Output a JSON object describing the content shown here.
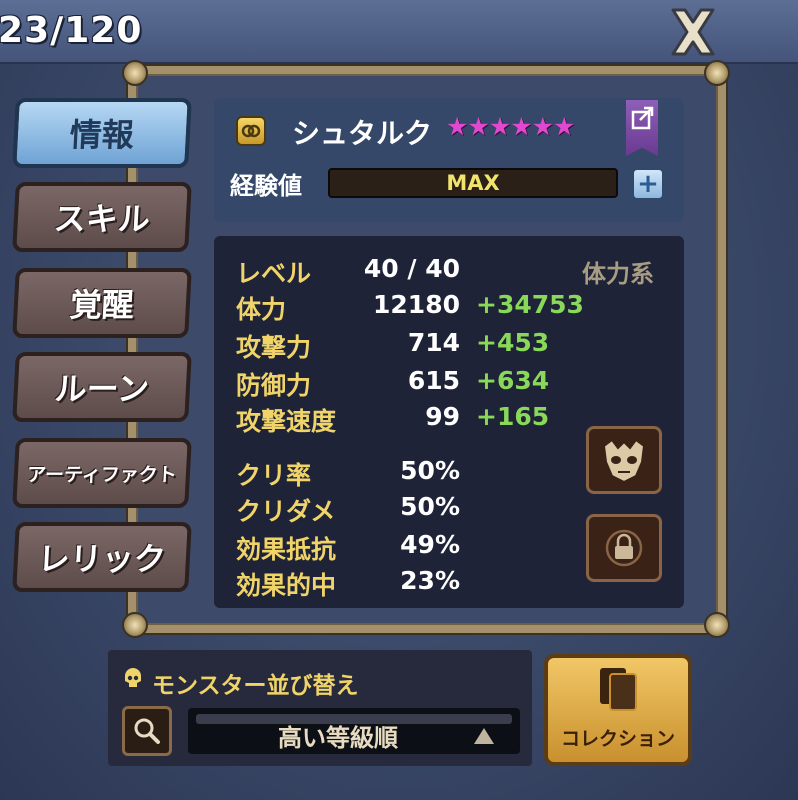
{
  "header": {
    "counter": "23/120",
    "close_icon": "close-x-icon"
  },
  "tabs": [
    {
      "label": "情報",
      "active": true
    },
    {
      "label": "スキル",
      "active": false
    },
    {
      "label": "覚醒",
      "active": false
    },
    {
      "label": "ルーン",
      "active": false
    },
    {
      "label": "アーティファクト",
      "active": false
    },
    {
      "label": "レリック",
      "active": false
    }
  ],
  "monster": {
    "name": "シュタルク",
    "stars": "★★★★★★",
    "star_color": "#e048d0",
    "element_icon": "element-light-icon",
    "exp_label": "経験値",
    "exp_value": "MAX"
  },
  "stats": {
    "type_label": "体力系",
    "rows": [
      {
        "label": "レベル",
        "value": "40 / 40",
        "bonus": ""
      },
      {
        "label": "体力",
        "value": "12180",
        "bonus": "+34753"
      },
      {
        "label": "攻撃力",
        "value": "714",
        "bonus": "+453"
      },
      {
        "label": "防御力",
        "value": "615",
        "bonus": "+634"
      },
      {
        "label": "攻撃速度",
        "value": "99",
        "bonus": "+165"
      },
      {
        "label": "クリ率",
        "value": "50%",
        "bonus": ""
      },
      {
        "label": "クリダメ",
        "value": "50%",
        "bonus": ""
      },
      {
        "label": "効果抵抗",
        "value": "49%",
        "bonus": ""
      },
      {
        "label": "効果的中",
        "value": "23%",
        "bonus": ""
      }
    ],
    "bonus_color": "#8ad85a",
    "label_color": "#f0d46a"
  },
  "sort": {
    "title": "モンスター並び替え",
    "value": "高い等級順"
  },
  "collection": {
    "label": "コレクション"
  }
}
